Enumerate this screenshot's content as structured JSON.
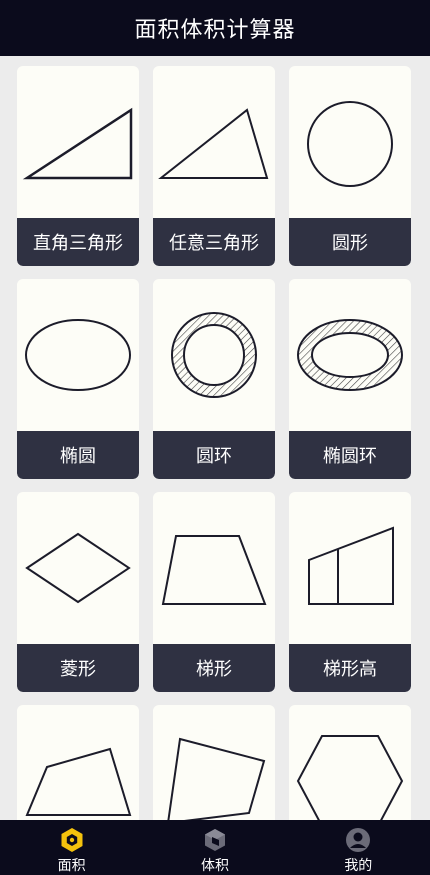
{
  "app": {
    "title": "面积体积计算器"
  },
  "cards": [
    {
      "label": "直角三角形",
      "icon": "right-triangle-icon"
    },
    {
      "label": "任意三角形",
      "icon": "triangle-icon"
    },
    {
      "label": "圆形",
      "icon": "circle-icon"
    },
    {
      "label": "椭圆",
      "icon": "ellipse-icon"
    },
    {
      "label": "圆环",
      "icon": "ring-icon"
    },
    {
      "label": "椭圆环",
      "icon": "elliptical-ring-icon"
    },
    {
      "label": "菱形",
      "icon": "rhombus-icon"
    },
    {
      "label": "梯形",
      "icon": "trapezoid-icon"
    },
    {
      "label": "梯形高",
      "icon": "trapezoid-height-icon"
    },
    {
      "label": "",
      "icon": "quadrilateral-icon"
    },
    {
      "label": "",
      "icon": "irregular-quadrilateral-icon"
    },
    {
      "label": "",
      "icon": "hexagon-icon"
    }
  ],
  "tabs": [
    {
      "label": "面积",
      "icon": "area-hexagon-icon",
      "active": true
    },
    {
      "label": "体积",
      "icon": "volume-cube-icon",
      "active": false
    },
    {
      "label": "我的",
      "icon": "profile-user-icon",
      "active": false
    }
  ],
  "colors": {
    "header_bg": "#0b0b1c",
    "label_bg": "#2f3142",
    "card_bg": "#fdfdf7",
    "active_tab": "#f4c20d",
    "inactive_tab": "#6b6b78"
  }
}
